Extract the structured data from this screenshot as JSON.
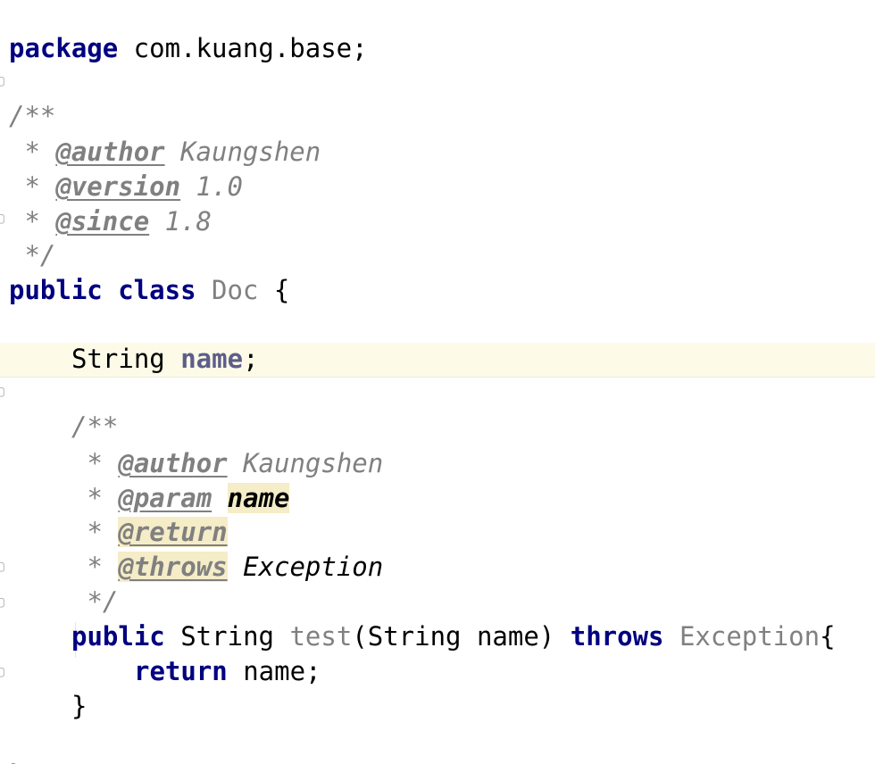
{
  "editor": {
    "package_kw": "package",
    "package_name": " com.kuang.base;",
    "class_doc": {
      "open": "/**",
      "star": " * ",
      "author_tag": "@author",
      "author_value": " Kaungshen",
      "version_tag": "@version",
      "version_value": " 1.0",
      "since_tag": "@since",
      "since_value": " 1.8",
      "close": " */"
    },
    "class_decl": {
      "public_kw": "public",
      "class_kw": " class",
      "class_name": " Doc",
      "brace": " {"
    },
    "field_decl": {
      "type": "String",
      "name": " name",
      "semicolon": ";"
    },
    "method_doc": {
      "open": "/**",
      "star": " * ",
      "author_tag": "@author",
      "author_value": " Kaungshen",
      "param_tag": "@param",
      "param_value": "name",
      "return_tag": "@return",
      "throws_tag": "@throws",
      "throws_value": " Exception",
      "close": " */"
    },
    "method_decl": {
      "public_kw": "public",
      "return_type": " String",
      "method_name": " test",
      "params": "(String name)",
      "throws_kw": " throws",
      "exception": " Exception",
      "brace": "{"
    },
    "return_stmt": {
      "return_kw": "return",
      "value": " name;"
    },
    "method_close": "}",
    "class_close": "}"
  }
}
